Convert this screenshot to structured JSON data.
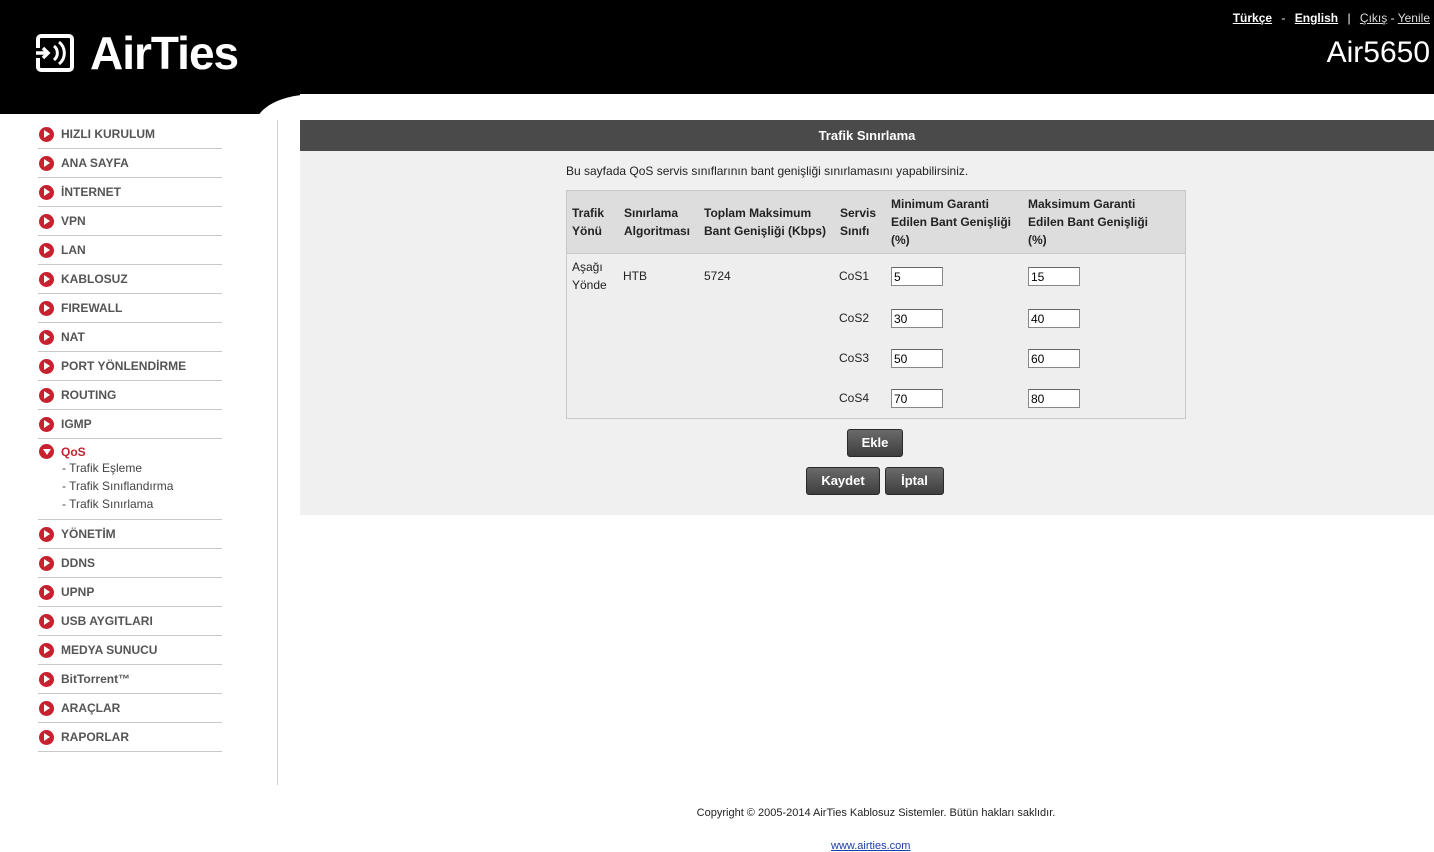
{
  "header": {
    "brand": "AirTies",
    "model": "Air5650",
    "links": {
      "lang_tr": "Türkçe",
      "dash1": "-",
      "lang_en": "English",
      "pipe": "|",
      "logout": "Çıkış",
      "dash2": "-",
      "refresh": "Yenile"
    }
  },
  "sidebar": {
    "items": [
      {
        "label": "HIZLI KURULUM"
      },
      {
        "label": "ANA SAYFA"
      },
      {
        "label": "İNTERNET"
      },
      {
        "label": "VPN"
      },
      {
        "label": "LAN"
      },
      {
        "label": "KABLOSUZ"
      },
      {
        "label": "FIREWALL"
      },
      {
        "label": "NAT"
      },
      {
        "label": "PORT YÖNLENDİRME"
      },
      {
        "label": "ROUTING"
      },
      {
        "label": "IGMP"
      },
      {
        "label": "QoS"
      },
      {
        "label": "YÖNETİM"
      },
      {
        "label": "DDNS"
      },
      {
        "label": "UPNP"
      },
      {
        "label": "USB AYGITLARI"
      },
      {
        "label": "MEDYA SUNUCU"
      },
      {
        "label": "BitTorrent™"
      },
      {
        "label": "ARAÇLAR"
      },
      {
        "label": "RAPORLAR"
      }
    ],
    "qos_sub": [
      {
        "label": "- Trafik Eşleme"
      },
      {
        "label": "- Trafik Sınıflandırma"
      },
      {
        "label": "- Trafik Sınırlama"
      }
    ]
  },
  "main": {
    "title": "Trafik Sınırlama",
    "description": "Bu sayfada QoS servis sınıflarının bant genişliği sınırlamasını yapabilirsiniz.",
    "table": {
      "headers": {
        "direction": [
          "Trafik",
          "Yönü"
        ],
        "algorithm": [
          "Sınırlama",
          "Algoritması"
        ],
        "total": [
          "Toplam Maksimum",
          "Bant Genişliği (Kbps)"
        ],
        "class": [
          "Servis",
          "Sınıfı"
        ],
        "min": [
          "Minimum Garanti",
          "Edilen Bant Genişliği",
          "(%)"
        ],
        "max": [
          "Maksimum Garanti",
          "Edilen Bant Genişliği",
          "(%)"
        ]
      },
      "direction": [
        "Aşağı",
        "Yönde"
      ],
      "algorithm": "HTB",
      "total": "5724",
      "rows": [
        {
          "class": "CoS1",
          "min": "5",
          "max": "15"
        },
        {
          "class": "CoS2",
          "min": "30",
          "max": "40"
        },
        {
          "class": "CoS3",
          "min": "50",
          "max": "60"
        },
        {
          "class": "CoS4",
          "min": "70",
          "max": "80"
        }
      ]
    },
    "buttons": {
      "add": "Ekle",
      "save": "Kaydet",
      "cancel": "İptal"
    }
  },
  "footer": {
    "copyright": "Copyright © 2005-2014 AirTies Kablosuz Sistemler. Bütün hakları saklıdır.",
    "link": "www.airties.com"
  }
}
